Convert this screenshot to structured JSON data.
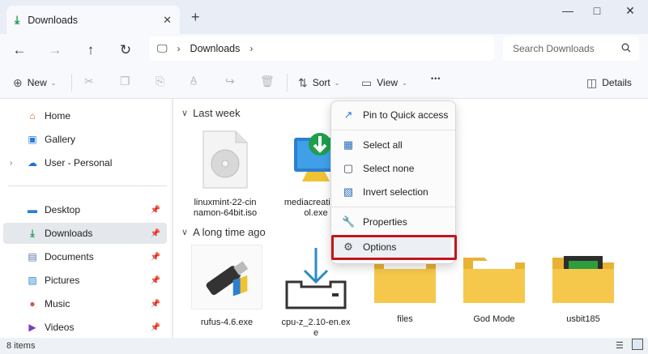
{
  "tab": {
    "title": "Downloads",
    "close_icon": "close-icon"
  },
  "address": {
    "location": "Downloads"
  },
  "search": {
    "placeholder": "Search Downloads"
  },
  "commands": {
    "new_label": "New",
    "sort_label": "Sort",
    "view_label": "View",
    "more_label": "•••",
    "details_label": "Details"
  },
  "sidebar": {
    "items": [
      {
        "label": "Home",
        "icon": "home-icon"
      },
      {
        "label": "Gallery",
        "icon": "gallery-icon"
      },
      {
        "label": "User - Personal",
        "icon": "cloud-icon"
      },
      {
        "label": "Desktop",
        "icon": "desktop-icon"
      },
      {
        "label": "Downloads",
        "icon": "download-icon"
      },
      {
        "label": "Documents",
        "icon": "documents-icon"
      },
      {
        "label": "Pictures",
        "icon": "pictures-icon"
      },
      {
        "label": "Music",
        "icon": "music-icon"
      },
      {
        "label": "Videos",
        "icon": "videos-icon"
      }
    ]
  },
  "groups": {
    "last_week": "Last week",
    "long_ago": "A long time ago"
  },
  "files_last_week": [
    {
      "name1": "linuxmint-22-cin",
      "name2": "namon-64bit.iso"
    },
    {
      "name1": "mediacreationto",
      "name2": "ol.exe"
    }
  ],
  "files_long_ago": [
    {
      "name1": "rufus-4.6.exe",
      "name2": ""
    },
    {
      "name1": "cpu-z_2.10-en.ex",
      "name2": "e"
    },
    {
      "name1": "files",
      "name2": ""
    },
    {
      "name1": "God Mode",
      "name2": ""
    },
    {
      "name1": "usbit185",
      "name2": ""
    }
  ],
  "menu": {
    "items": [
      {
        "label": "Pin to Quick access",
        "icon": "pin-icon"
      },
      {
        "label": "Select all",
        "icon": "select-all-icon"
      },
      {
        "label": "Select none",
        "icon": "select-none-icon"
      },
      {
        "label": "Invert selection",
        "icon": "invert-selection-icon"
      },
      {
        "label": "Properties",
        "icon": "wrench-icon"
      },
      {
        "label": "Options",
        "icon": "gear-icon"
      }
    ]
  },
  "status": {
    "count": "8 items"
  },
  "colors": {
    "accent": "#1a9a4a",
    "folder": "#f5c84c",
    "highlight": "#c4151c"
  }
}
